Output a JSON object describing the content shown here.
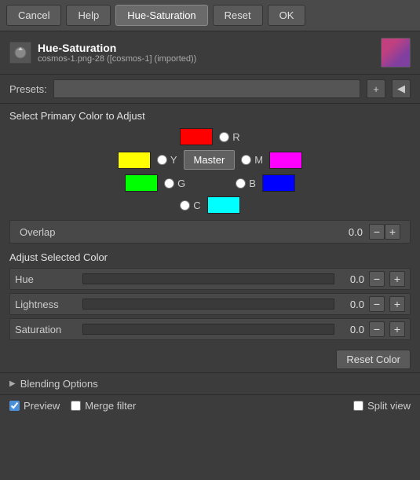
{
  "toolbar": {
    "cancel_label": "Cancel",
    "help_label": "Help",
    "active_label": "Hue-Saturation",
    "reset_label": "Reset",
    "ok_label": "OK"
  },
  "header": {
    "title": "Hue-Saturation",
    "subtitle": "cosmos-1.png-28 ([cosmos-1] (imported))"
  },
  "presets": {
    "label": "Presets:",
    "placeholder": ""
  },
  "select_color": {
    "title": "Select Primary Color to Adjust",
    "colors": {
      "R_label": "R",
      "Y_label": "Y",
      "G_label": "G",
      "C_label": "C",
      "B_label": "B",
      "M_label": "M"
    },
    "master_label": "Master"
  },
  "overlap": {
    "label": "Overlap",
    "value": "0.0"
  },
  "adjust": {
    "title": "Adjust Selected Color",
    "hue_label": "Hue",
    "hue_value": "0.0",
    "lightness_label": "Lightness",
    "lightness_value": "0.0",
    "saturation_label": "Saturation",
    "saturation_value": "0.0"
  },
  "reset_color": {
    "label": "Reset Color"
  },
  "blending": {
    "label": "Blending Options"
  },
  "bottom": {
    "preview_label": "Preview",
    "merge_label": "Merge filter",
    "split_label": "Split view"
  }
}
